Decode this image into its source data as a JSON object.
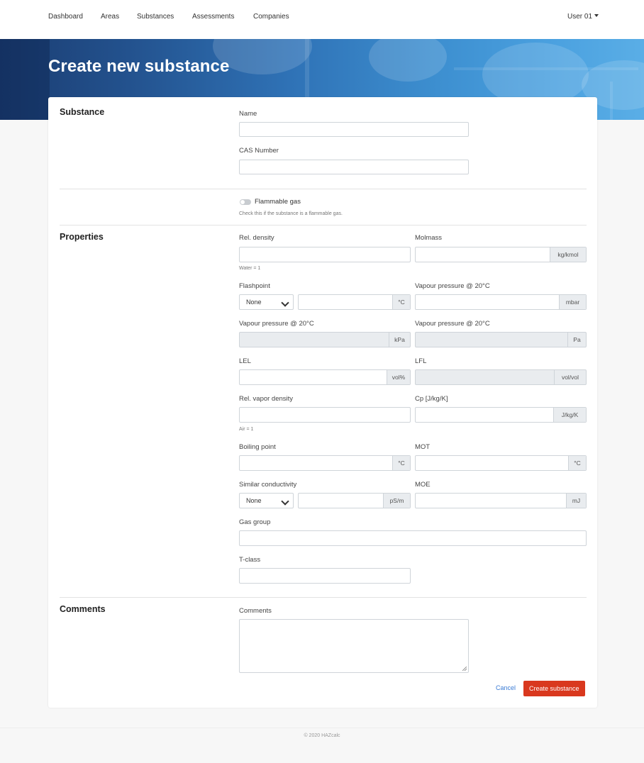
{
  "nav": {
    "items": [
      "Dashboard",
      "Areas",
      "Substances",
      "Assessments",
      "Companies"
    ],
    "user": "User 01"
  },
  "page": {
    "title": "Create new substance"
  },
  "sections": {
    "substance": "Substance",
    "properties": "Properties",
    "comments": "Comments"
  },
  "fields": {
    "name": {
      "label": "Name",
      "value": ""
    },
    "cas": {
      "label": "CAS Number",
      "value": ""
    },
    "flammable": {
      "label": "Flammable gas",
      "hint": "Check this if the substance is a flammable gas.",
      "checked": false
    },
    "rel_density": {
      "label": "Rel. density",
      "hint": "Water = 1",
      "value": ""
    },
    "molmass": {
      "label": "Molmass",
      "unit": "kg/kmol",
      "value": ""
    },
    "flashpoint": {
      "label": "Flashpoint",
      "select": "None",
      "unit": "°C",
      "value": ""
    },
    "vp_mbar": {
      "label": "Vapour pressure @ 20°C",
      "unit": "mbar",
      "value": ""
    },
    "vp_kpa": {
      "label": "Vapour pressure @ 20°C",
      "unit": "kPa"
    },
    "vp_pa": {
      "label": "Vapour pressure @ 20°C",
      "unit": "Pa"
    },
    "lel": {
      "label": "LEL",
      "unit": "vol%",
      "value": ""
    },
    "lfl": {
      "label": "LFL",
      "unit": "vol/vol"
    },
    "rel_vapor_density": {
      "label": "Rel. vapor density",
      "hint": "Air = 1",
      "value": ""
    },
    "cp": {
      "label": "Cp [J/kg/K]",
      "unit": "J/kg/K",
      "value": ""
    },
    "boiling_point": {
      "label": "Boiling point",
      "unit": "°C",
      "value": ""
    },
    "mot": {
      "label": "MOT",
      "unit": "°C",
      "value": ""
    },
    "conductivity": {
      "label": "Similar conductivity",
      "select": "None",
      "unit": "pS/m",
      "value": ""
    },
    "moe": {
      "label": "MOE",
      "unit": "mJ",
      "value": ""
    },
    "gas_group": {
      "label": "Gas group",
      "value": ""
    },
    "t_class": {
      "label": "T-class",
      "value": ""
    },
    "comments": {
      "label": "Comments",
      "value": ""
    }
  },
  "actions": {
    "cancel": "Cancel",
    "create": "Create substance"
  },
  "footer": "© 2020 HAZcalc",
  "colors": {
    "accent": "#d9381e",
    "link": "#3a7bd5",
    "banner": "#23528e"
  }
}
